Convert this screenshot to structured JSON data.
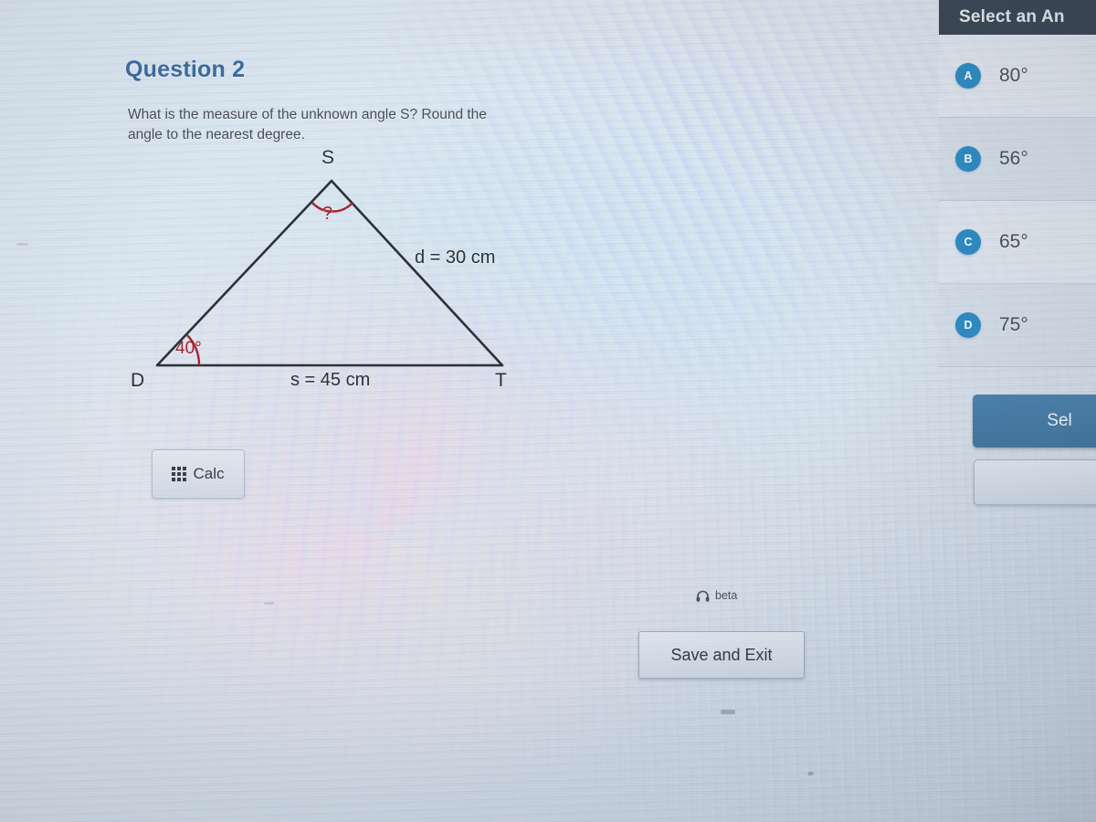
{
  "question": {
    "title": "Question 2",
    "prompt": "What is the measure of the unknown angle S? Round the angle to the nearest degree."
  },
  "diagram": {
    "vertex_s": "S",
    "vertex_d": "D",
    "vertex_t": "T",
    "side_d": "d = 30 cm",
    "side_s": "s = 45 cm",
    "unknown_angle": "?",
    "known_angle": "40°",
    "line_color": "#2d3138",
    "arc_color": "#a8242f"
  },
  "toolbar": {
    "calc_label": "Calc",
    "calc_icon": "grid-keypad-icon"
  },
  "footer": {
    "beta_label": "beta",
    "beta_icon": "headphones-icon",
    "save_exit_label": "Save and Exit"
  },
  "answer_panel": {
    "header": "Select an An",
    "accent_color": "#2e8dc4",
    "header_bg": "#3c4754",
    "options": [
      {
        "letter": "A",
        "value": "80°"
      },
      {
        "letter": "B",
        "value": "56°"
      },
      {
        "letter": "C",
        "value": "65°"
      },
      {
        "letter": "D",
        "value": "75°"
      }
    ],
    "select_button_label": "Sel",
    "select_button_color": "#4d83ae"
  }
}
